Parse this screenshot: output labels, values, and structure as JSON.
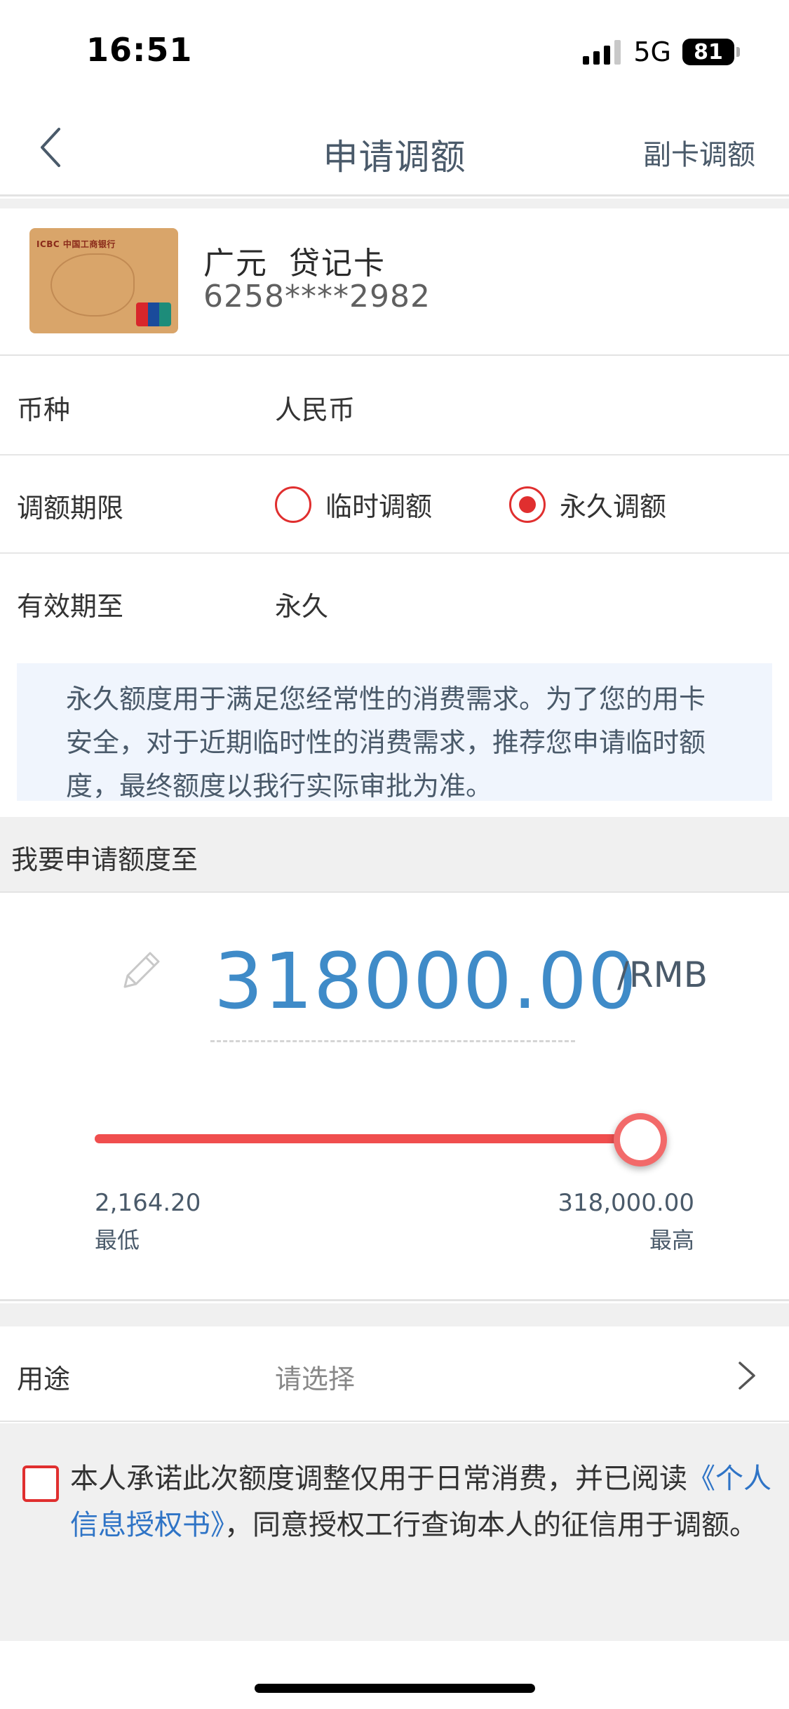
{
  "status_bar": {
    "time": "16:51",
    "network": "5G",
    "battery": "81"
  },
  "nav": {
    "title": "申请调额",
    "action": "副卡调额"
  },
  "card": {
    "name_part1": "广元",
    "name_part2": "贷记卡",
    "number": "6258****2982",
    "image_text": "ICBC 中国工商银行"
  },
  "currency": {
    "label": "币种",
    "value": "人民币"
  },
  "term": {
    "label": "调额期限",
    "options": [
      "临时调额",
      "永久调额"
    ],
    "selected": "永久调额"
  },
  "valid_until": {
    "label": "有效期至",
    "value": "永久"
  },
  "notice": "永久额度用于满足您经常性的消费需求。为了您的用卡安全，对于近期临时性的消费需求，推荐您申请临时额度，最终额度以我行实际审批为准。",
  "amount_section": {
    "heading": "我要申请额度至",
    "amount": "318000.00",
    "unit": "/RMB",
    "min_value": "2,164.20",
    "min_label": "最低",
    "max_value": "318,000.00",
    "max_label": "最高",
    "slider_fraction": 1.0
  },
  "purpose": {
    "label": "用途",
    "placeholder": "请选择"
  },
  "consent": {
    "text_before": "本人承诺此次额度调整仅用于日常消费，并已阅读",
    "link": "《个人信息授权书》",
    "text_after": "，同意授权工行查询本人的征信用于调额。",
    "checked": false
  },
  "colors": {
    "accent_red": "#e02f2f",
    "amount_blue": "#3f8bc8",
    "link_blue": "#2f74c6",
    "nav_text": "#4a5a6a"
  }
}
